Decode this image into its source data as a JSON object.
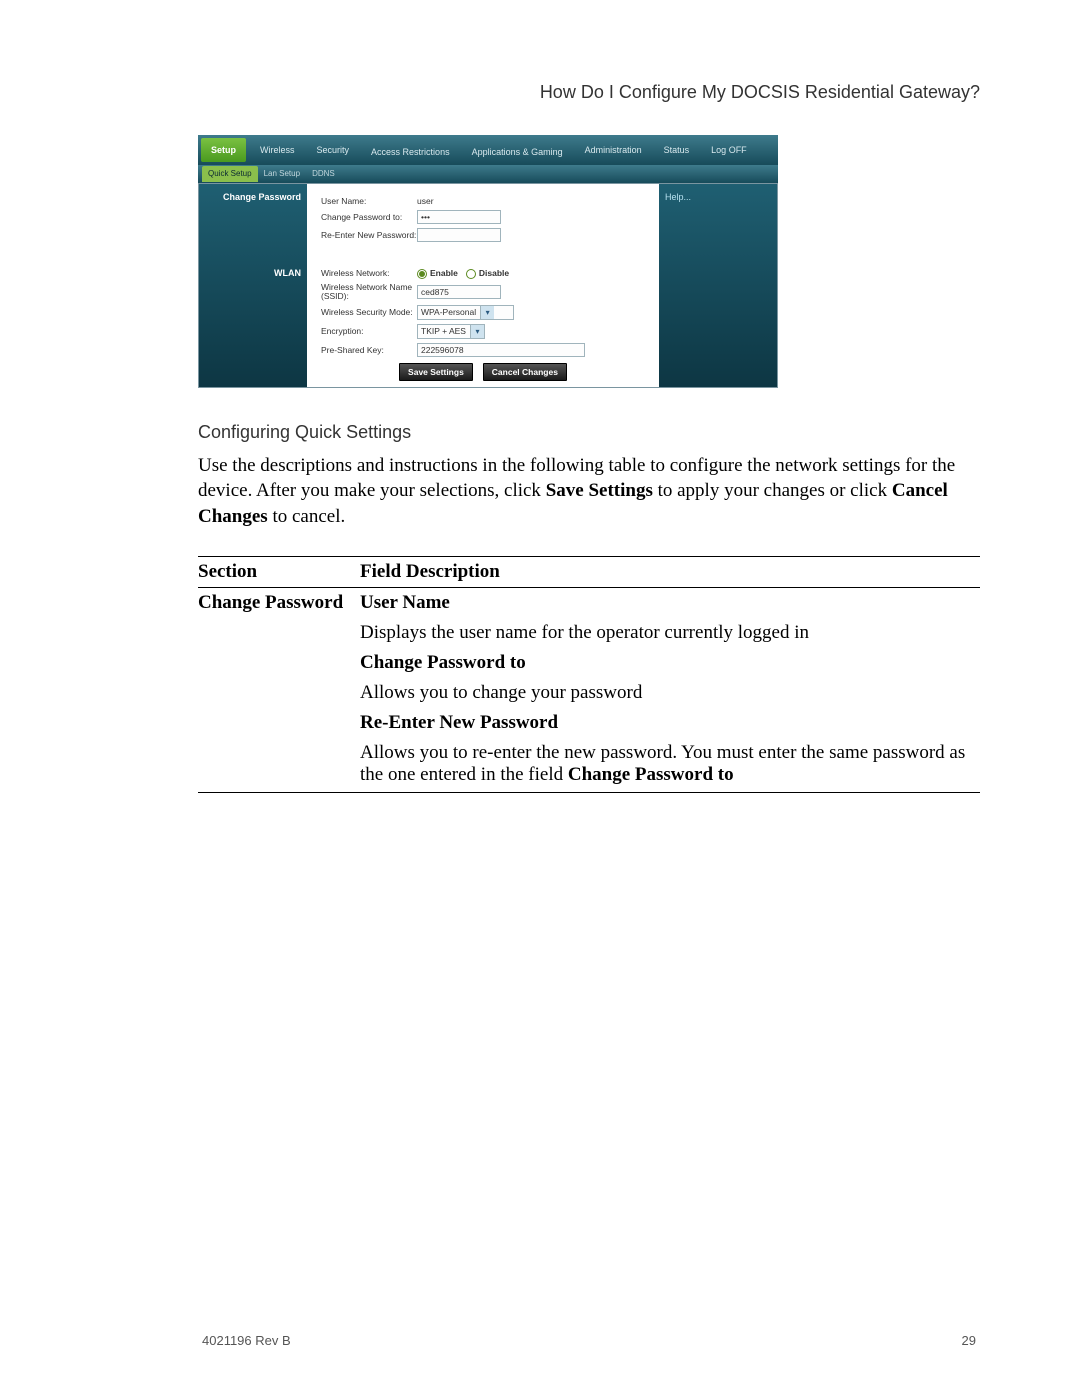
{
  "header": {
    "title": "How Do I Configure My DOCSIS Residential Gateway?"
  },
  "router": {
    "tabs": [
      "Setup",
      "Wireless",
      "Security",
      "Access Restrictions",
      "Applications & Gaming",
      "Administration",
      "Status",
      "Log OFF"
    ],
    "subtabs": [
      "Quick Setup",
      "Lan Setup",
      "DDNS"
    ],
    "sections": {
      "change_password": "Change Password",
      "wlan": "WLAN"
    },
    "labels": {
      "user_name": "User Name:",
      "change_pw": "Change Password to:",
      "reenter_pw": "Re-Enter New Password:",
      "wnet": "Wireless Network:",
      "ssid": "Wireless Network Name (SSID):",
      "secmode": "Wireless Security Mode:",
      "enc": "Encryption:",
      "psk": "Pre-Shared Key:"
    },
    "values": {
      "user_name": "user",
      "password_mask": "•••",
      "enable": "Enable",
      "disable": "Disable",
      "ssid": "ced875",
      "secmode": "WPA-Personal",
      "enc": "TKIP + AES",
      "psk": "222596078"
    },
    "help": "Help...",
    "buttons": {
      "save": "Save Settings",
      "cancel": "Cancel Changes"
    }
  },
  "caption": "Configuring Quick Settings",
  "paragraph": {
    "p1a": "Use the descriptions and instructions in the following table to configure the network settings for the device. After you make your selections, click ",
    "p1b": "Save Settings",
    "p1c": " to apply your changes or click ",
    "p1d": "Cancel Changes",
    "p1e": " to cancel."
  },
  "table": {
    "h1": "Section",
    "h2": "Field Description",
    "section1": "Change Password",
    "r1a": "User Name",
    "r1b": "Displays the user name for the operator currently logged in",
    "r2a": "Change Password to",
    "r2b": "Allows you to change your password",
    "r3a": "Re-Enter New Password",
    "r3b_a": "Allows you to re-enter the new password. You must enter the same password as the one entered in the field ",
    "r3b_b": "Change Password to"
  },
  "footer": {
    "left": "4021196 Rev B",
    "right": "29"
  }
}
